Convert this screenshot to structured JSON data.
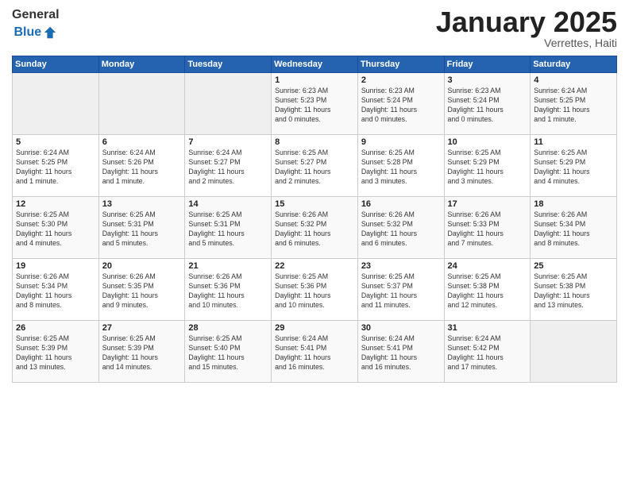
{
  "header": {
    "logo_general": "General",
    "logo_blue": "Blue",
    "month": "January 2025",
    "location": "Verrettes, Haiti"
  },
  "weekdays": [
    "Sunday",
    "Monday",
    "Tuesday",
    "Wednesday",
    "Thursday",
    "Friday",
    "Saturday"
  ],
  "weeks": [
    [
      {
        "day": "",
        "info": ""
      },
      {
        "day": "",
        "info": ""
      },
      {
        "day": "",
        "info": ""
      },
      {
        "day": "1",
        "info": "Sunrise: 6:23 AM\nSunset: 5:23 PM\nDaylight: 11 hours\nand 0 minutes."
      },
      {
        "day": "2",
        "info": "Sunrise: 6:23 AM\nSunset: 5:24 PM\nDaylight: 11 hours\nand 0 minutes."
      },
      {
        "day": "3",
        "info": "Sunrise: 6:23 AM\nSunset: 5:24 PM\nDaylight: 11 hours\nand 0 minutes."
      },
      {
        "day": "4",
        "info": "Sunrise: 6:24 AM\nSunset: 5:25 PM\nDaylight: 11 hours\nand 1 minute."
      }
    ],
    [
      {
        "day": "5",
        "info": "Sunrise: 6:24 AM\nSunset: 5:25 PM\nDaylight: 11 hours\nand 1 minute."
      },
      {
        "day": "6",
        "info": "Sunrise: 6:24 AM\nSunset: 5:26 PM\nDaylight: 11 hours\nand 1 minute."
      },
      {
        "day": "7",
        "info": "Sunrise: 6:24 AM\nSunset: 5:27 PM\nDaylight: 11 hours\nand 2 minutes."
      },
      {
        "day": "8",
        "info": "Sunrise: 6:25 AM\nSunset: 5:27 PM\nDaylight: 11 hours\nand 2 minutes."
      },
      {
        "day": "9",
        "info": "Sunrise: 6:25 AM\nSunset: 5:28 PM\nDaylight: 11 hours\nand 3 minutes."
      },
      {
        "day": "10",
        "info": "Sunrise: 6:25 AM\nSunset: 5:29 PM\nDaylight: 11 hours\nand 3 minutes."
      },
      {
        "day": "11",
        "info": "Sunrise: 6:25 AM\nSunset: 5:29 PM\nDaylight: 11 hours\nand 4 minutes."
      }
    ],
    [
      {
        "day": "12",
        "info": "Sunrise: 6:25 AM\nSunset: 5:30 PM\nDaylight: 11 hours\nand 4 minutes."
      },
      {
        "day": "13",
        "info": "Sunrise: 6:25 AM\nSunset: 5:31 PM\nDaylight: 11 hours\nand 5 minutes."
      },
      {
        "day": "14",
        "info": "Sunrise: 6:25 AM\nSunset: 5:31 PM\nDaylight: 11 hours\nand 5 minutes."
      },
      {
        "day": "15",
        "info": "Sunrise: 6:26 AM\nSunset: 5:32 PM\nDaylight: 11 hours\nand 6 minutes."
      },
      {
        "day": "16",
        "info": "Sunrise: 6:26 AM\nSunset: 5:32 PM\nDaylight: 11 hours\nand 6 minutes."
      },
      {
        "day": "17",
        "info": "Sunrise: 6:26 AM\nSunset: 5:33 PM\nDaylight: 11 hours\nand 7 minutes."
      },
      {
        "day": "18",
        "info": "Sunrise: 6:26 AM\nSunset: 5:34 PM\nDaylight: 11 hours\nand 8 minutes."
      }
    ],
    [
      {
        "day": "19",
        "info": "Sunrise: 6:26 AM\nSunset: 5:34 PM\nDaylight: 11 hours\nand 8 minutes."
      },
      {
        "day": "20",
        "info": "Sunrise: 6:26 AM\nSunset: 5:35 PM\nDaylight: 11 hours\nand 9 minutes."
      },
      {
        "day": "21",
        "info": "Sunrise: 6:26 AM\nSunset: 5:36 PM\nDaylight: 11 hours\nand 10 minutes."
      },
      {
        "day": "22",
        "info": "Sunrise: 6:25 AM\nSunset: 5:36 PM\nDaylight: 11 hours\nand 10 minutes."
      },
      {
        "day": "23",
        "info": "Sunrise: 6:25 AM\nSunset: 5:37 PM\nDaylight: 11 hours\nand 11 minutes."
      },
      {
        "day": "24",
        "info": "Sunrise: 6:25 AM\nSunset: 5:38 PM\nDaylight: 11 hours\nand 12 minutes."
      },
      {
        "day": "25",
        "info": "Sunrise: 6:25 AM\nSunset: 5:38 PM\nDaylight: 11 hours\nand 13 minutes."
      }
    ],
    [
      {
        "day": "26",
        "info": "Sunrise: 6:25 AM\nSunset: 5:39 PM\nDaylight: 11 hours\nand 13 minutes."
      },
      {
        "day": "27",
        "info": "Sunrise: 6:25 AM\nSunset: 5:39 PM\nDaylight: 11 hours\nand 14 minutes."
      },
      {
        "day": "28",
        "info": "Sunrise: 6:25 AM\nSunset: 5:40 PM\nDaylight: 11 hours\nand 15 minutes."
      },
      {
        "day": "29",
        "info": "Sunrise: 6:24 AM\nSunset: 5:41 PM\nDaylight: 11 hours\nand 16 minutes."
      },
      {
        "day": "30",
        "info": "Sunrise: 6:24 AM\nSunset: 5:41 PM\nDaylight: 11 hours\nand 16 minutes."
      },
      {
        "day": "31",
        "info": "Sunrise: 6:24 AM\nSunset: 5:42 PM\nDaylight: 11 hours\nand 17 minutes."
      },
      {
        "day": "",
        "info": ""
      }
    ]
  ]
}
